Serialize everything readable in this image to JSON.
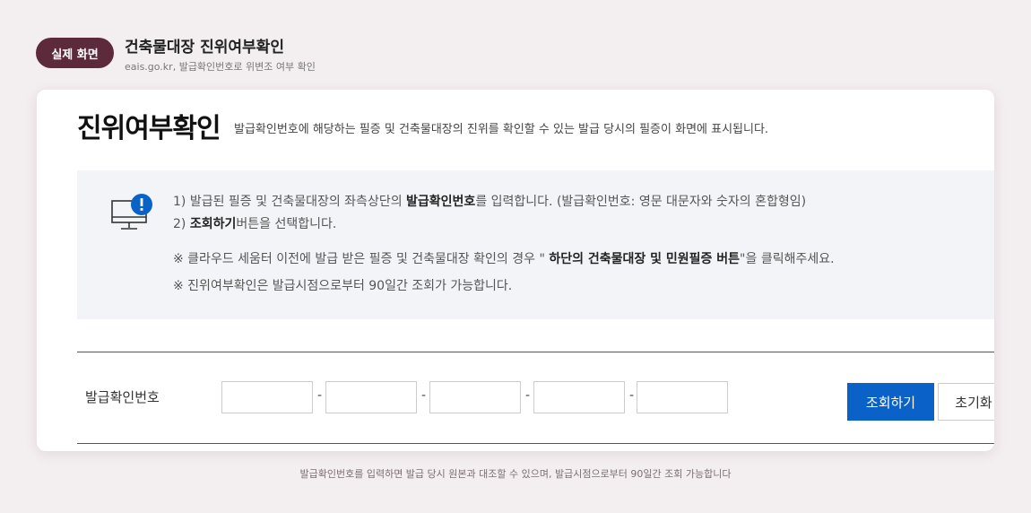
{
  "header": {
    "badge": "실제 화면",
    "title": "건축물대장 진위여부확인",
    "subtitle": "eais.go.kr, 발급확인번호로 위변조 여부 확인"
  },
  "page": {
    "title": "진위여부확인",
    "description": "발급확인번호에 해당하는 필증 및 건축물대장의 진위를 확인할 수 있는 발급 당시의 필증이 화면에 표시됩니다."
  },
  "info": {
    "icon": "monitor-alert-icon",
    "line1_pre": "1) 발급된 필증 및 건축물대장의 좌측상단의 ",
    "line1_bold": "발급확인번호",
    "line1_post": "를 입력합니다. (발급확인번호: 영문 대문자와 숫자의 혼합형임)",
    "line2_pre": "2) ",
    "line2_bold": "조회하기",
    "line2_post": "버튼을 선택합니다.",
    "note1_pre": "※ 클라우드 세움터 이전에 발급 받은 필증 및 건축물대장 확인의 경우 \" ",
    "note1_bold": "하단의 건축물대장 및 민원필증 버튼",
    "note1_post": "\"을 클릭해주세요.",
    "note2": "※ 진위여부확인은 발급시점으로부터 90일간 조회가 가능합니다."
  },
  "form": {
    "label": "발급확인번호",
    "fields": [
      "",
      "",
      "",
      "",
      ""
    ],
    "separator": "-",
    "search_button": "조회하기",
    "reset_button": "초기화"
  },
  "footer": {
    "note": "발급확인번호를 입력하면 발급 당시 원본과 대조할 수 있으며, 발급시점으로부터 90일간 조회 가능합니다"
  },
  "colors": {
    "background": "#f3eef0",
    "badge": "#5c2a3a",
    "primary_button": "#0a62c9",
    "alert_icon": "#0a62c9"
  }
}
